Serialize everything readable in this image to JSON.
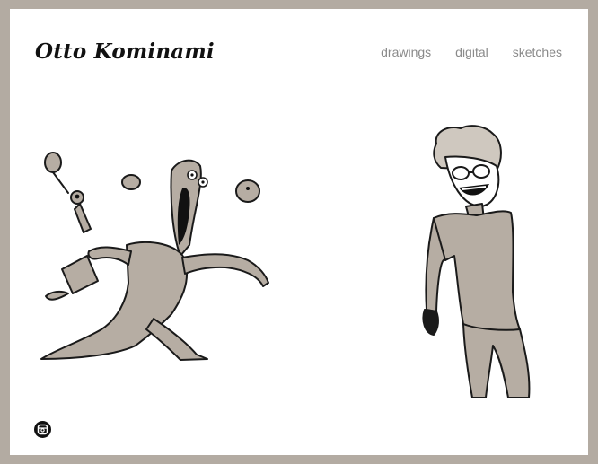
{
  "header": {
    "site_title": "Otto Kominami"
  },
  "nav": {
    "items": [
      {
        "label": "drawings"
      },
      {
        "label": "digital"
      },
      {
        "label": "sketches"
      }
    ]
  },
  "gallery": {
    "artworks": [
      {
        "subject": "tall screaming creature lunging with small floating critters"
      },
      {
        "subject": "curly-haired figure with glasses in t-shirt, grinning"
      }
    ]
  },
  "footer": {
    "social_icon": "instagram-icon"
  },
  "colors": {
    "background": "#b3aba2",
    "page": "#ffffff",
    "nav_text": "#8a8a8a",
    "title_text": "#111111",
    "figure_fill": "#b6ada3"
  }
}
